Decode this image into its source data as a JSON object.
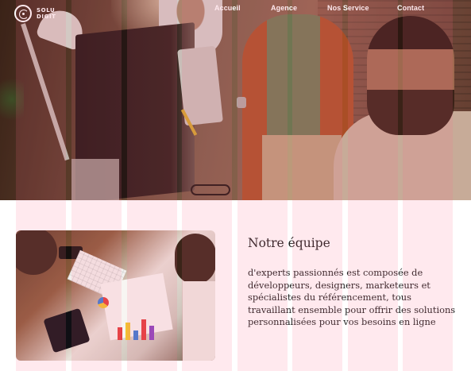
{
  "brand": {
    "logo_line1": "SOLU",
    "logo_line2": "DIGIT"
  },
  "nav": {
    "items": [
      {
        "label": "Accueil"
      },
      {
        "label": "Agence"
      },
      {
        "label": "Nos Service"
      },
      {
        "label": "Contact"
      }
    ]
  },
  "team_section": {
    "title": "Notre équipe",
    "description": "d'experts passionnés est composée de développeurs, designers, marketeurs et spécialistes du référencement, tous travaillant ensemble pour offrir des solutions personnalisées pour vos besoins en ligne"
  },
  "colors": {
    "nav_text": "#ffffff",
    "body_text": "#1e1e1e",
    "grid_overlay": "rgba(255,110,140,0.15)"
  },
  "icons": {
    "logo": "spiral-circle-icon"
  }
}
